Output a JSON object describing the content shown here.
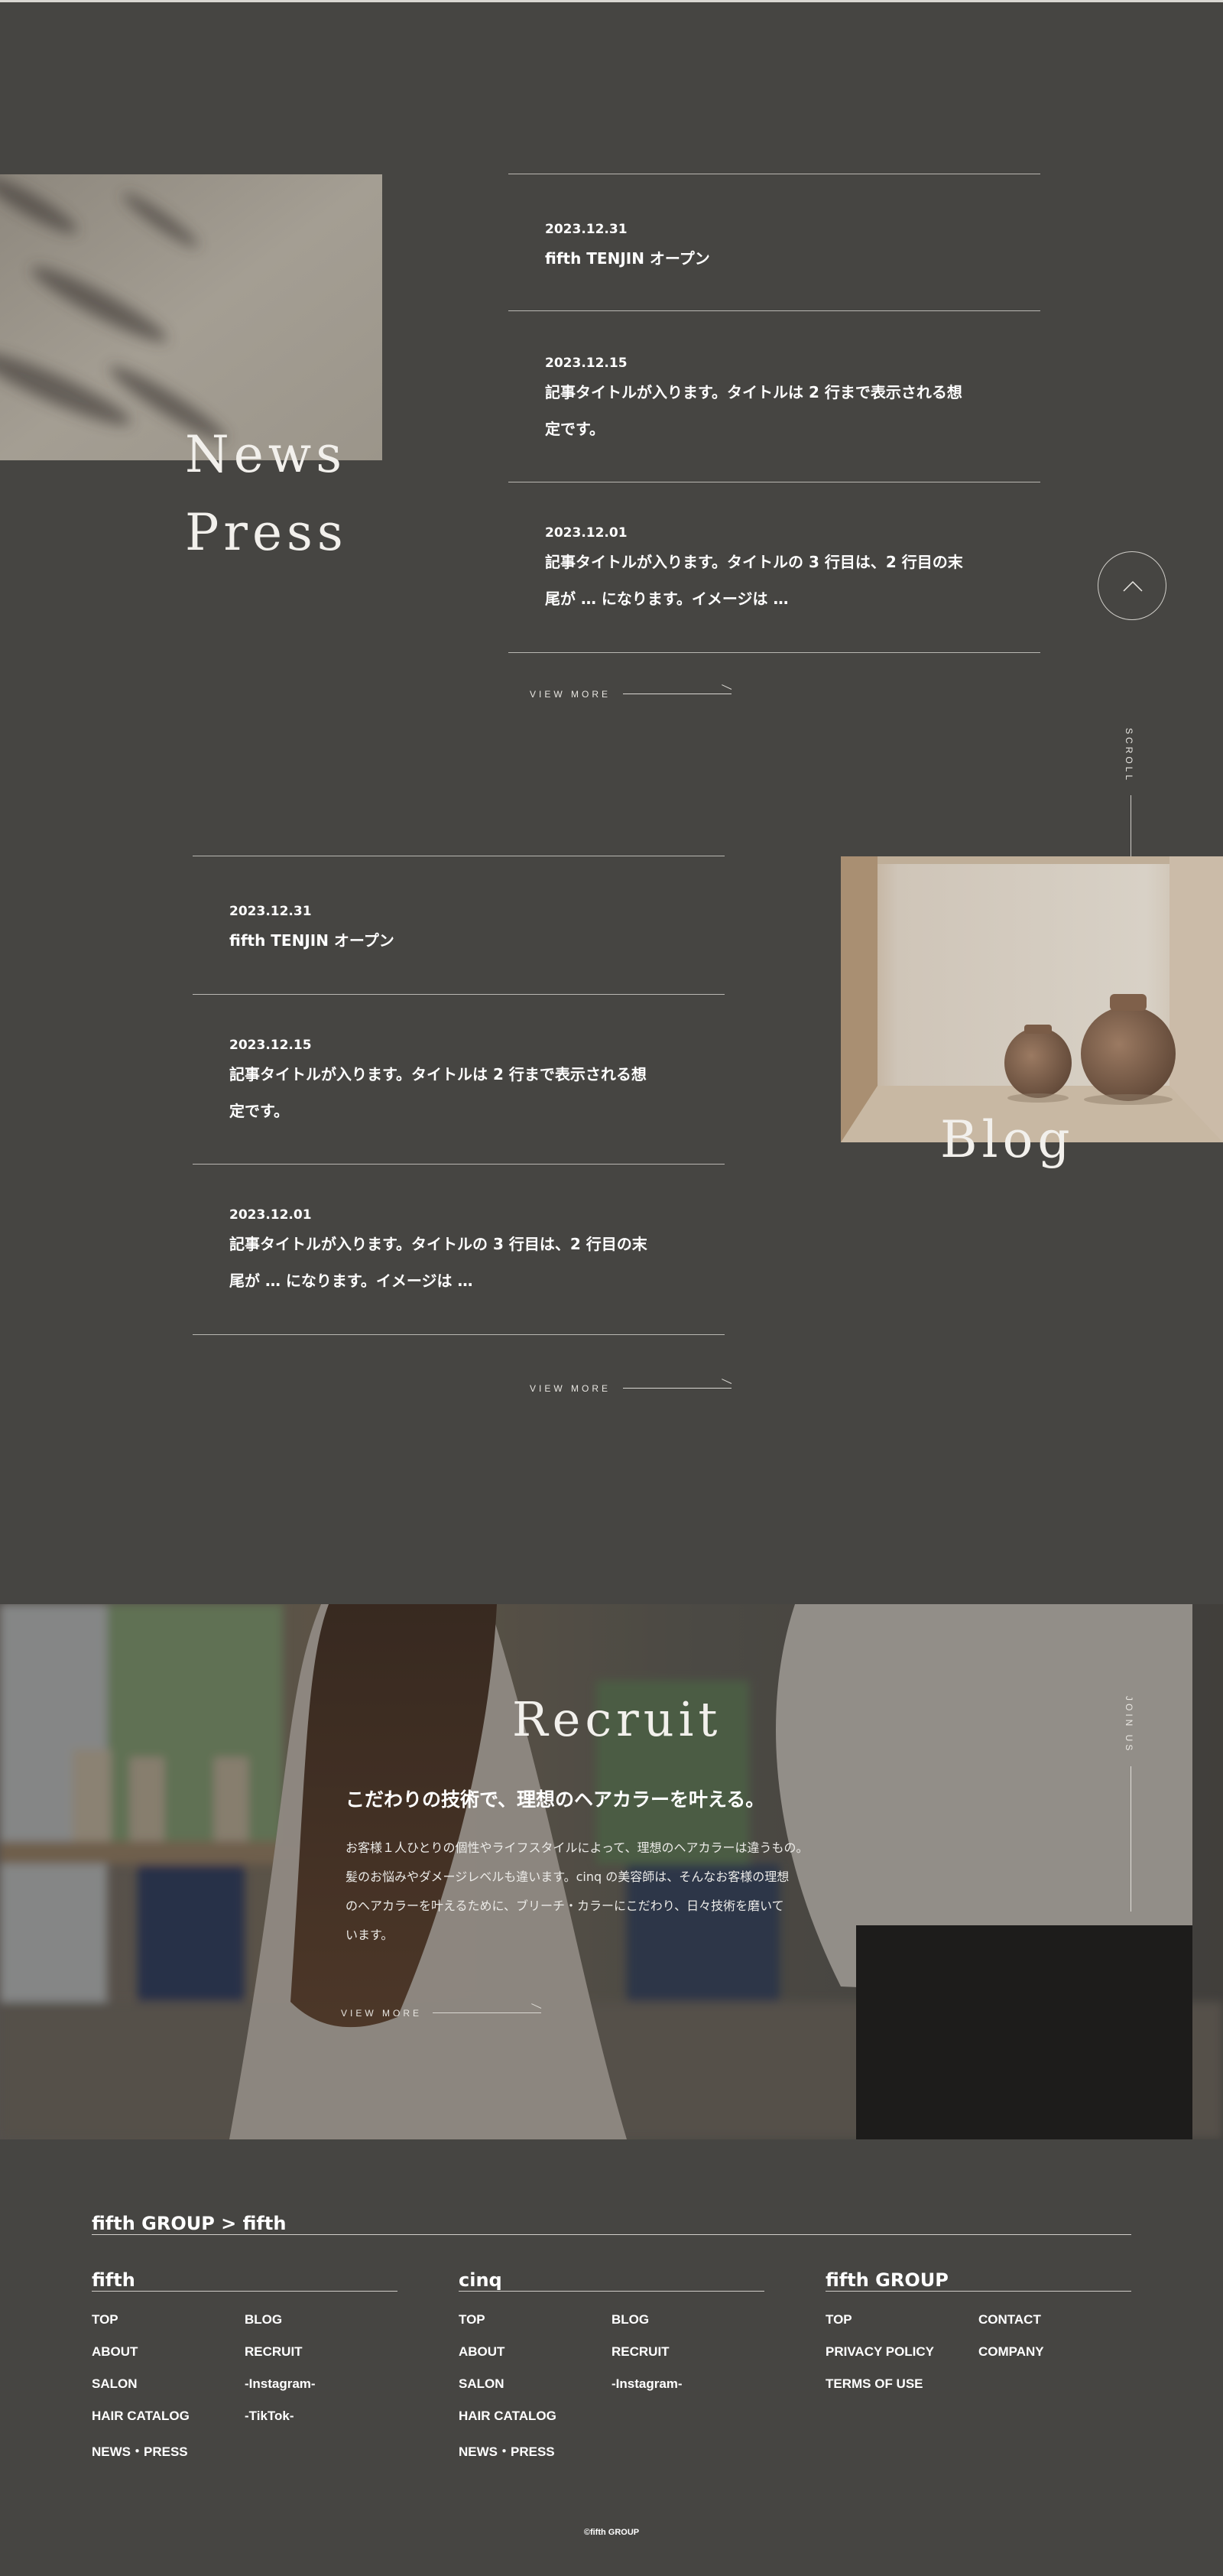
{
  "news": {
    "titles": [
      "News",
      "Press"
    ],
    "items": [
      {
        "date": "2023.12.31",
        "title_lines": [
          "fifth TENJIN オープン"
        ]
      },
      {
        "date": "2023.12.15",
        "title_lines": [
          "記事タイトルが入ります。タイトルは 2 行まで表示される想",
          "定です。"
        ]
      },
      {
        "date": "2023.12.01",
        "title_lines": [
          "記事タイトルが入ります。タイトルの 3 行目は、2 行目の末",
          "尾が … になります。イメージは …"
        ]
      }
    ],
    "view_more": "VIEW MORE"
  },
  "blog": {
    "title": "Blog",
    "items": [
      {
        "date": "2023.12.31",
        "title_lines": [
          "fifth TENJIN オープン"
        ]
      },
      {
        "date": "2023.12.15",
        "title_lines": [
          "記事タイトルが入ります。タイトルは 2 行まで表示される想",
          "定です。"
        ]
      },
      {
        "date": "2023.12.01",
        "title_lines": [
          "記事タイトルが入ります。タイトルの 3 行目は、2 行目の末",
          "尾が … になります。イメージは …"
        ]
      }
    ],
    "view_more": "VIEW MORE"
  },
  "side": {
    "scroll_label": "SCROLL",
    "join_label": "JOIN US",
    "scroll_icon": "chevron-up-icon"
  },
  "recruit": {
    "title": "Recruit",
    "heading": "こだわりの技術で、理想のヘアカラーを叶える。",
    "body_lines": [
      "お客様１人ひとりの個性やライフスタイルによって、理想のヘアカラーは違うもの。",
      "髪のお悩みやダメージレベルも違います。cinq の美容師は、そんなお客様の理想",
      "のヘアカラーを叶えるために、ブリーチ・カラーにこだわり、日々技術を磨いて",
      "います。"
    ],
    "view_more": "VIEW MORE"
  },
  "footer": {
    "breadcrumb": "fifth GROUP > fifth",
    "columns": [
      {
        "title": "fifth",
        "links": [
          "TOP",
          "ABOUT",
          "SALON",
          "HAIR CATALOG",
          "NEWS・PRESS",
          "BLOG",
          "RECRUIT",
          "-Instagram-",
          "-TikTok-"
        ]
      },
      {
        "title": "cinq",
        "links": [
          "TOP",
          "ABOUT",
          "SALON",
          "HAIR CATALOG",
          "NEWS・PRESS",
          "BLOG",
          "RECRUIT",
          "-Instagram-"
        ]
      },
      {
        "title": "fifth GROUP",
        "links": [
          "TOP",
          "PRIVACY POLICY",
          "TERMS OF USE",
          "CONTACT",
          "COMPANY"
        ]
      }
    ],
    "copyright": "©fifth GROUP"
  },
  "colors": {
    "background": "#464542",
    "line": "#b9b7b2",
    "text": "#ffffff"
  }
}
